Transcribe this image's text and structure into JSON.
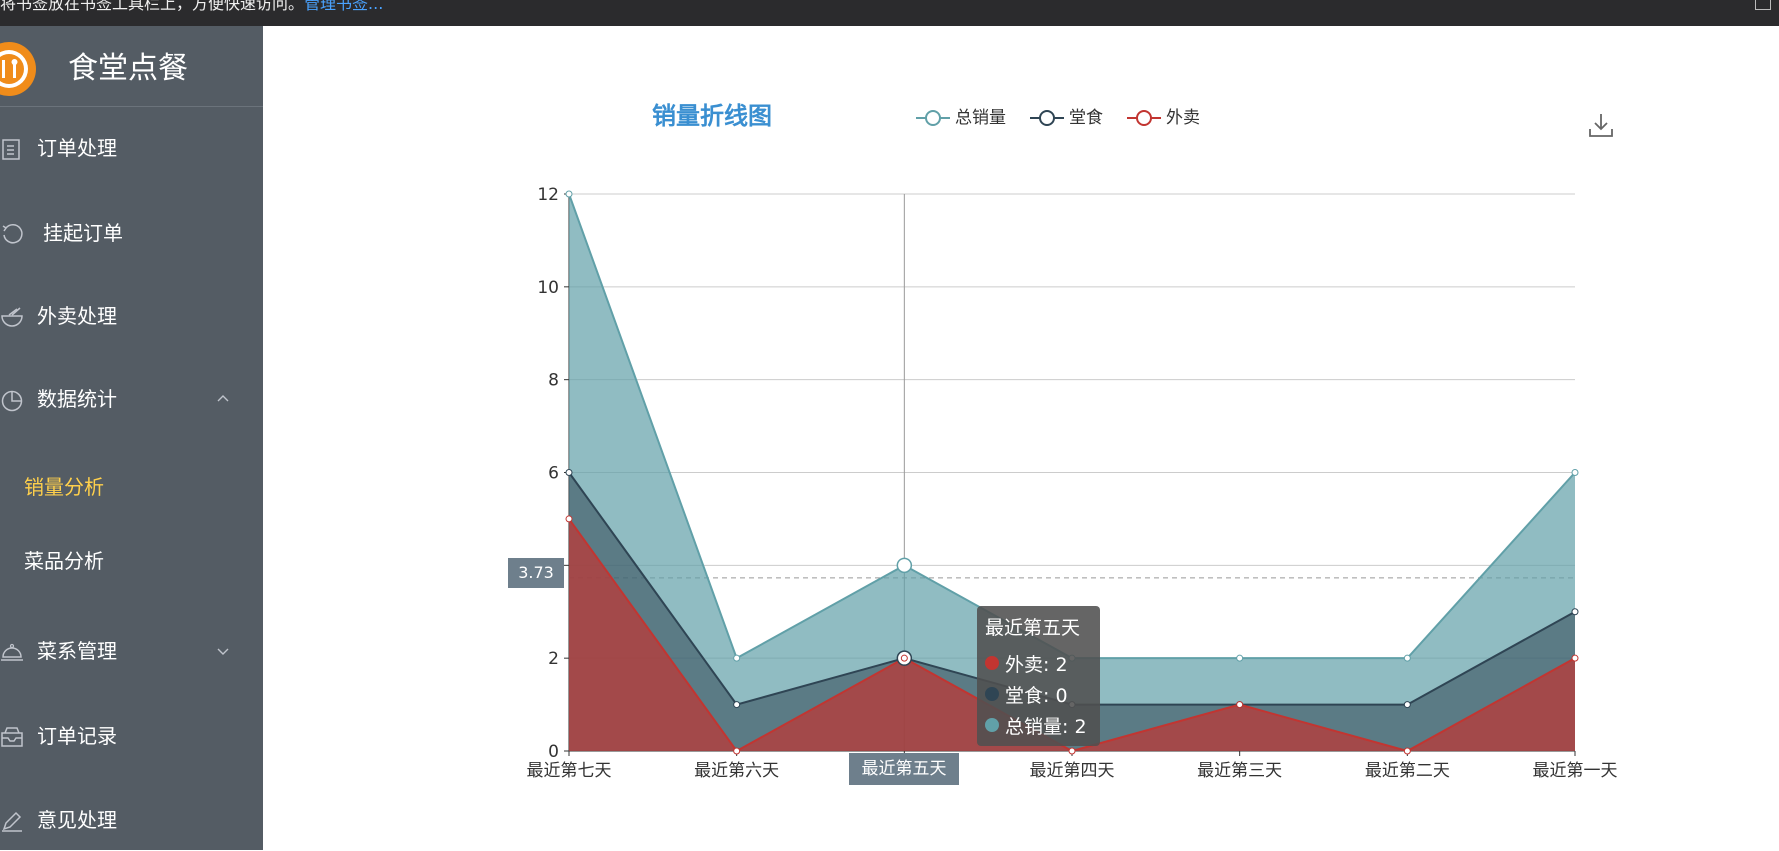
{
  "topbar": {
    "message": "将书签放在书签工具栏上，方便快速访问。",
    "link": "管理书签..."
  },
  "sidebar": {
    "title": "食堂点餐",
    "menu": [
      {
        "label": "订单处理",
        "icon": "document-icon"
      },
      {
        "label": "挂起订单",
        "icon": "refresh-icon"
      },
      {
        "label": "外卖处理",
        "icon": "bowl-icon"
      },
      {
        "label": "数据统计",
        "icon": "pie-chart-icon",
        "expanded": true
      },
      {
        "label": "菜系管理",
        "icon": "cloche-icon",
        "expanded": false
      },
      {
        "label": "订单记录",
        "icon": "inbox-icon"
      },
      {
        "label": "意见处理",
        "icon": "pen-icon"
      }
    ],
    "submenu": [
      {
        "label": "销量分析",
        "active": true
      },
      {
        "label": "菜品分析",
        "active": false
      }
    ],
    "colors": {
      "bg": "#545c64",
      "active_text": "#ffd04b"
    }
  },
  "chart": {
    "title": "销量折线图",
    "legend": [
      "总销量",
      "堂食",
      "外卖"
    ],
    "axis_pointer_y": "3.73",
    "axis_pointer_x": "最近第五天",
    "tooltip": {
      "title": "最近第五天",
      "rows": [
        {
          "label": "外卖: 2",
          "color": "#c23531"
        },
        {
          "label": "堂食: 0",
          "color": "#2f4554"
        },
        {
          "label": "总销量: 2",
          "color": "#61a0a8"
        }
      ]
    }
  },
  "chart_data": {
    "type": "area",
    "title": "销量折线图",
    "categories": [
      "最近第七天",
      "最近第六天",
      "最近第五天",
      "最近第四天",
      "最近第三天",
      "最近第二天",
      "最近第一天"
    ],
    "series": [
      {
        "name": "总销量",
        "color": "#61a0a8",
        "values": [
          12,
          2,
          4,
          2,
          2,
          2,
          6
        ]
      },
      {
        "name": "堂食",
        "color": "#2f4554",
        "values": [
          6,
          1,
          2,
          1,
          1,
          1,
          3
        ]
      },
      {
        "name": "外卖",
        "color": "#c23531",
        "values": [
          5,
          0,
          2,
          0,
          1,
          0,
          2
        ]
      }
    ],
    "yticks": [
      "0",
      "2",
      "4",
      "6",
      "8",
      "10",
      "12"
    ],
    "ylim": [
      0,
      12
    ],
    "grid": true,
    "legend_position": "top"
  }
}
